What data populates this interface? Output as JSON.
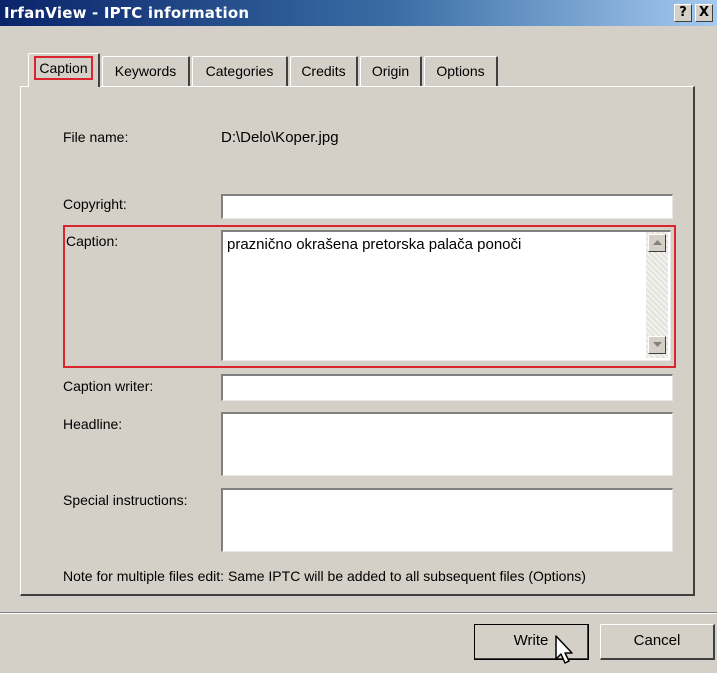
{
  "window": {
    "title": "IrfanView - IPTC information",
    "help_label": "?",
    "close_label": "X"
  },
  "tabs": [
    {
      "label": "Caption",
      "active": true
    },
    {
      "label": "Keywords",
      "active": false
    },
    {
      "label": "Categories",
      "active": false
    },
    {
      "label": "Credits",
      "active": false
    },
    {
      "label": "Origin",
      "active": false
    },
    {
      "label": "Options",
      "active": false
    }
  ],
  "form": {
    "file_name_label": "File name:",
    "file_name_value": "D:\\Delo\\Koper.jpg",
    "copyright_label": "Copyright:",
    "copyright_value": "",
    "caption_label": "Caption:",
    "caption_value": "praznično okrašena pretorska palača ponoči",
    "caption_writer_label": "Caption writer:",
    "caption_writer_value": "",
    "headline_label": "Headline:",
    "headline_value": "",
    "special_instructions_label": "Special instructions:",
    "special_instructions_value": "",
    "note": "Note for multiple files edit: Same IPTC will be added to all subsequent files (Options)"
  },
  "buttons": {
    "write_label": "Write",
    "cancel_label": "Cancel"
  },
  "colors": {
    "titlebar_start": "#0a246a",
    "titlebar_end": "#a6caf0",
    "dialog_face": "#d4d0c8",
    "highlight_red": "#d9262e"
  },
  "icons": {
    "scroll_up": "arrow-up-icon",
    "scroll_down": "arrow-down-icon",
    "cursor": "mouse-pointer-icon"
  }
}
